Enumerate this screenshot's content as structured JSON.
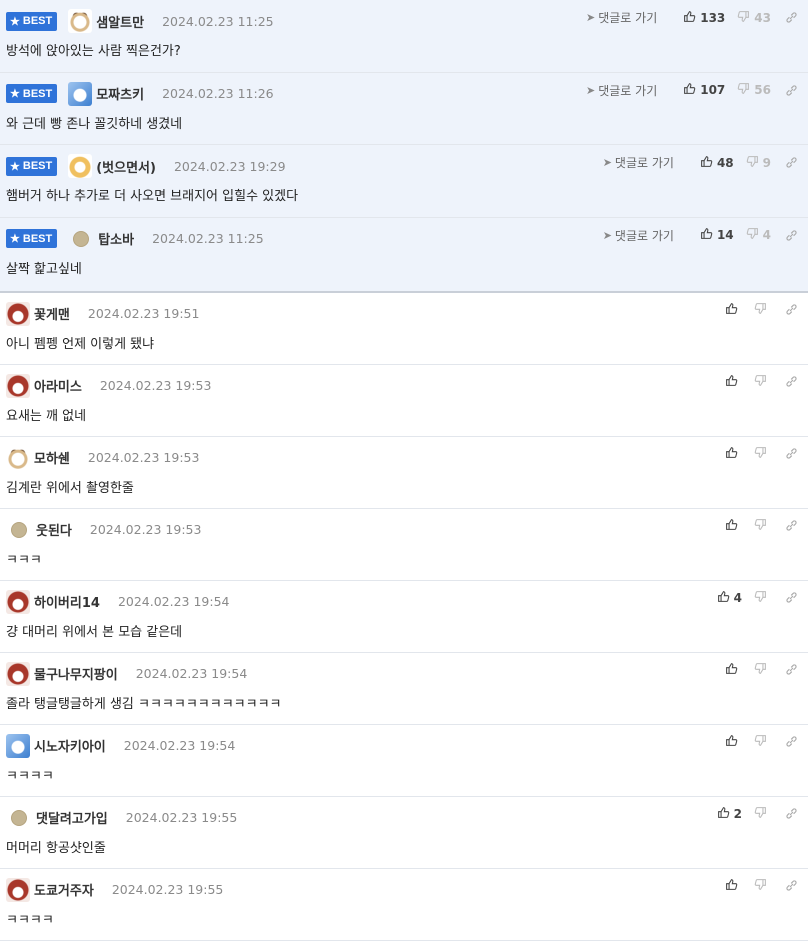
{
  "labels": {
    "best": "BEST",
    "goto_reply": "댓글로 가기"
  },
  "best_comments": [
    {
      "nick": "샘알트만",
      "date": "2024.02.23 11:25",
      "text": "방석에 앉아있는 사람 찍은건가?",
      "up": "133",
      "down": "43",
      "avatar": "dog-avatar"
    },
    {
      "nick": "모짜츠키",
      "date": "2024.02.23 11:26",
      "text": "와 근데 빵 존나 꼴깃하네 생겼네",
      "up": "107",
      "down": "56",
      "avatar": "husky-avatar"
    },
    {
      "nick": "(벗으면서)",
      "date": "2024.02.23 19:29",
      "text": "햄버거 하나 추가로 더 사오면 브래지어 입힐수 있겠다",
      "up": "48",
      "down": "9",
      "avatar": "fox-avatar"
    },
    {
      "nick": "탑소바",
      "date": "2024.02.23 11:25",
      "text": "살짝 핥고싶네",
      "up": "14",
      "down": "4",
      "avatar": "default-avatar"
    }
  ],
  "comments": [
    {
      "nick": "꽃게맨",
      "date": "2024.02.23 19:51",
      "text": "아니 펨펭 언제 이렇게 됐냐",
      "up": "",
      "avatar": "bear-avatar"
    },
    {
      "nick": "아라미스",
      "date": "2024.02.23 19:53",
      "text": "요새는 깨 없네",
      "up": "",
      "avatar": "lion-avatar"
    },
    {
      "nick": "모하쉔",
      "date": "2024.02.23 19:53",
      "text": "김계란 위에서 촬영한줄",
      "up": "",
      "avatar": "dog-avatar"
    },
    {
      "nick": "웃된다",
      "date": "2024.02.23 19:53",
      "text": "ㅋㅋㅋ",
      "up": "",
      "avatar": "default-avatar"
    },
    {
      "nick": "하이버리14",
      "date": "2024.02.23 19:54",
      "text": "걍 대머리 위에서 본 모습 같은데",
      "up": "4",
      "avatar": "bear-avatar"
    },
    {
      "nick": "물구나무지팡이",
      "date": "2024.02.23 19:54",
      "text": "졸라 탱글탱글하게 생김 ㅋㅋㅋㅋㅋㅋㅋㅋㅋㅋㅋㅋ",
      "up": "",
      "avatar": "bear-avatar"
    },
    {
      "nick": "시노자키아이",
      "date": "2024.02.23 19:54",
      "text": "ㅋㅋㅋㅋ",
      "up": "",
      "avatar": "husky-avatar"
    },
    {
      "nick": "댓달려고가입",
      "date": "2024.02.23 19:55",
      "text": "머머리 항공샷인줄",
      "up": "2",
      "avatar": "default-avatar"
    },
    {
      "nick": "도쿄거주자",
      "date": "2024.02.23 19:55",
      "text": "ㅋㅋㅋㅋ",
      "up": "",
      "avatar": "bear-avatar"
    }
  ],
  "colors": {
    "best_bg": "#eef3fb",
    "badge": "#2f73d9"
  }
}
